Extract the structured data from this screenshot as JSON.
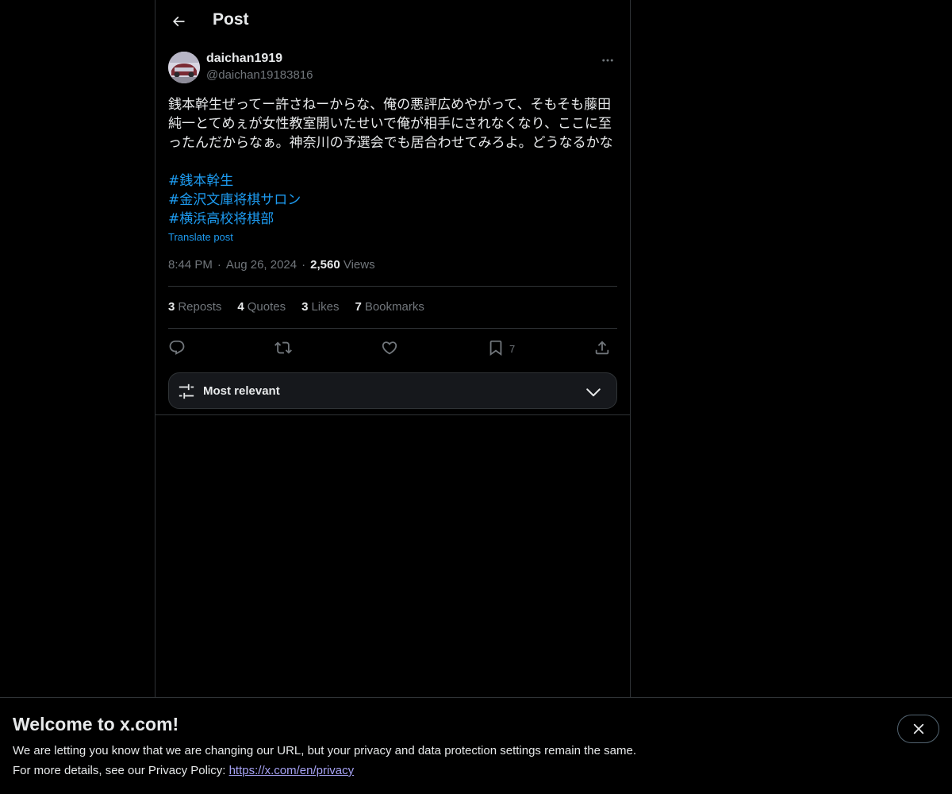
{
  "header": {
    "title": "Post"
  },
  "post": {
    "author": {
      "display_name": "daichan1919",
      "handle": "@daichan19183816"
    },
    "text": "銭本幹生ぜってー許さねーからな、俺の悪評広めやがって、そもそも藤田純一とてめぇが女性教室開いたせいで俺が相手にされなくなり、ここに至ったんだからなぁ。神奈川の予選会でも居合わせてみろよ。どうなるかな",
    "hashtags": [
      "#銭本幹生",
      "#金沢文庫将棋サロン",
      "#横浜高校将棋部"
    ],
    "translate_label": "Translate post",
    "time": "8:44 PM",
    "date": "Aug 26, 2024",
    "views_count": "2,560",
    "views_label": "Views"
  },
  "stats": [
    {
      "count": "3",
      "label": "Reposts"
    },
    {
      "count": "4",
      "label": "Quotes"
    },
    {
      "count": "3",
      "label": "Likes"
    },
    {
      "count": "7",
      "label": "Bookmarks"
    }
  ],
  "actions": {
    "reply_icon": "reply-icon",
    "repost_icon": "repost-icon",
    "like_icon": "heart-icon",
    "bookmark_icon": "bookmark-icon",
    "bookmark_count": "7",
    "share_icon": "share-icon"
  },
  "sort": {
    "label": "Most relevant"
  },
  "banner": {
    "title": "Welcome to x.com!",
    "line1": "We are letting you know that we are changing our URL, but your privacy and data protection settings remain the same.",
    "line2_prefix": "For more details, see our Privacy Policy: ",
    "link_text": "https://x.com/en/privacy"
  },
  "colors": {
    "accent": "#1d9bf0",
    "text": "#e7e9ea",
    "muted": "#71767b",
    "border": "#2f3336",
    "background": "#000000"
  }
}
